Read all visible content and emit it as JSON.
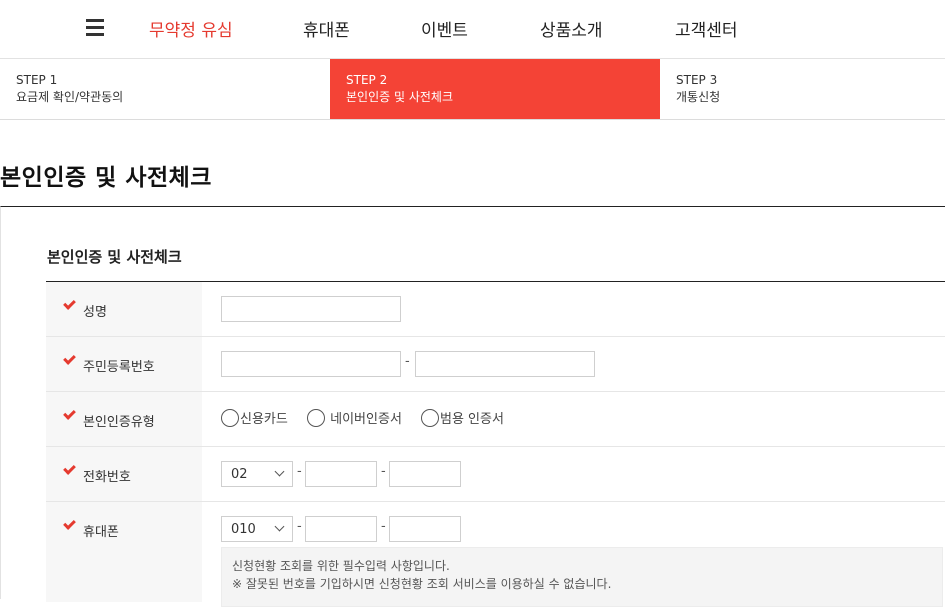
{
  "nav": {
    "items": [
      {
        "label": "무약정 유심",
        "active": true
      },
      {
        "label": "휴대폰",
        "active": false
      },
      {
        "label": "이벤트",
        "active": false
      },
      {
        "label": "상품소개",
        "active": false
      },
      {
        "label": "고객센터",
        "active": false
      }
    ],
    "active_color": "#e53a2f"
  },
  "steps": [
    {
      "num": "STEP 1",
      "label": "요금제 확인/약관동의",
      "active": false
    },
    {
      "num": "STEP 2",
      "label": "본인인증 및 사전체크",
      "active": true
    },
    {
      "num": "STEP 3",
      "label": "개통신청",
      "active": false
    }
  ],
  "accent_color": "#f44336",
  "page_title": "본인인증 및 사전체크",
  "section_title": "본인인증 및 사전체크",
  "form": {
    "name_label": "성명",
    "name_value": "",
    "rrn_label": "주민등록번호",
    "rrn_separator": "-",
    "auth_type_label": "본인인증유형",
    "auth_options": [
      "신용카드",
      "네이버인증서",
      "범용 인증서"
    ],
    "phone_label": "전화번호",
    "phone_prefix": "02",
    "phone_separator": "-",
    "mobile_label": "휴대폰",
    "mobile_prefix": "010",
    "mobile_separator": "-"
  },
  "notice": {
    "line1": "신청현황 조회를 위한 필수입력 사항입니다.",
    "line2": "※ 잘못된 번호를 기입하시면 신청현황 조회 서비스를 이용하실 수 없습니다."
  }
}
